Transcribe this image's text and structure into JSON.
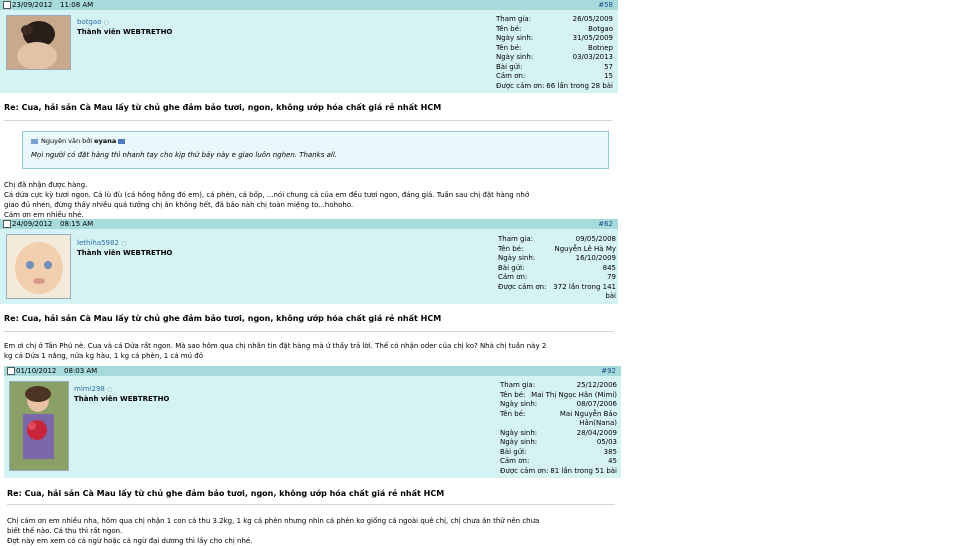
{
  "posts": [
    {
      "date": "23/09/2012",
      "time": "11:08 AM",
      "num": "#58",
      "username": "botgao",
      "user_title": "Thành viên WEBTRETHO",
      "stats": [
        {
          "k": "Tham gia:",
          "v": "26/05/2009"
        },
        {
          "k": "Tên bé:",
          "v": "Botgao"
        },
        {
          "k": "Ngày sinh:",
          "v": "31/05/2009"
        },
        {
          "k": "Tên bé:",
          "v": "Botnep"
        },
        {
          "k": "Ngày sinh:",
          "v": "03/03/2013"
        },
        {
          "k": "Bài gửi:",
          "v": "57"
        },
        {
          "k": "Cảm ơn:",
          "v": "15"
        },
        {
          "k": "Được cảm ơn:",
          "v": "66 lần trong 28 bài"
        }
      ],
      "title": "Re: Cua, hải sản Cà Mau lấy từ chủ ghe đảm bảo tươi, ngon, không ướp hóa chất giá rẻ nhất HCM",
      "quote_author_prefix": "Nguyên văn bởi",
      "quote_author": "eyana",
      "quote_text": "Mọi người có đặt hàng thì nhanh tay cho kịp thứ bảy này e giao luôn nghen. Thanks all.",
      "body": [
        "Chị đã nhận được hàng.",
        "Cá dứa cực kỳ tươi ngon. Cá lù đù (cá hồng hồng đó em), cá phèn, cá bốp, ...nói chung cá của em đều tươi ngon, đáng giá. Tuần sau chị đặt hàng nhớ",
        "giao đủ nhen, đừng thấy nhiều quá tưởng chị ăn không hết, đã bảo nàh chị toàn miệng to...hohoho.",
        "Cám ơn em nhiều nhé."
      ]
    },
    {
      "date": "24/09/2012",
      "time": "08:15 AM",
      "num": "#62",
      "username": "lethiha5982",
      "user_title": "Thành viên WEBTRETHO",
      "stats": [
        {
          "k": "Tham gia:",
          "v": "09/05/2008"
        },
        {
          "k": "Tên bé:",
          "v": "Nguyễn Lê Hà My"
        },
        {
          "k": "Ngày sinh:",
          "v": "16/10/2009"
        },
        {
          "k": "Bài gửi:",
          "v": "845"
        },
        {
          "k": "Cảm ơn:",
          "v": "79"
        },
        {
          "k": "Được cảm ơn:",
          "v": "372 lần trong 141"
        },
        {
          "k": "",
          "v": "bài"
        }
      ],
      "title": "Re: Cua, hải sản Cà Mau lấy từ chủ ghe đảm bảo tươi, ngon, không ướp hóa chất giá rẻ nhất HCM",
      "body": [
        "Em ơi chị ở Tân Phú nè. Cua và cá Dứa rất ngon. Mà sao hôm qua chị nhắn tin đặt hàng mà ứ thấy trả lời. Thế có nhận oder của chị ko? Nhà chị tuần này 2",
        "kg cá Dứa 1 nắng, nửa kg hàu, 1 kg cá phèn, 1 cá mú đỏ"
      ]
    },
    {
      "date": "01/10/2012",
      "time": "08:03 AM",
      "num": "#92",
      "username": "mimi298",
      "user_title": "Thành viên WEBTRETHO",
      "stats": [
        {
          "k": "Tham gia:",
          "v": "25/12/2006"
        },
        {
          "k": "Tên bé:",
          "v": "Mai Thị Ngọc Hân (Mimi)"
        },
        {
          "k": "Ngày sinh:",
          "v": "08/07/2006"
        },
        {
          "k": "Tên bé:",
          "v": "Mai Nguyễn Bảo"
        },
        {
          "k": "",
          "v": "Hân(Nana)"
        },
        {
          "k": "Ngày sinh:",
          "v": "28/04/2009"
        },
        {
          "k": "Ngày sinh:",
          "v": "05/03"
        },
        {
          "k": "Bài gửi:",
          "v": "385"
        },
        {
          "k": "Cảm ơn:",
          "v": "45"
        },
        {
          "k": "Được cảm ơn:",
          "v": "81 lần trong 51 bài"
        }
      ],
      "title": "Re: Cua, hải sản Cà Mau lấy từ chủ ghe đảm bảo tươi, ngon, không ướp hóa chất giá rẻ nhất HCM",
      "body": [
        "Chị cám ơn em nhiều nha, hôm qua chị nhận 1 con cá thu 3.2kg, 1 kg cá phèn nhưng nhìn cá phèn ko giống cá ngoài quê chị, chị chưa ăn thử nên chưa",
        "biết thế nào. Cá thu thì rất ngon.",
        "Đợt này em xem có cá ngừ hoặc cá ngừ đại dương thì lấy cho chị nhé."
      ]
    }
  ]
}
